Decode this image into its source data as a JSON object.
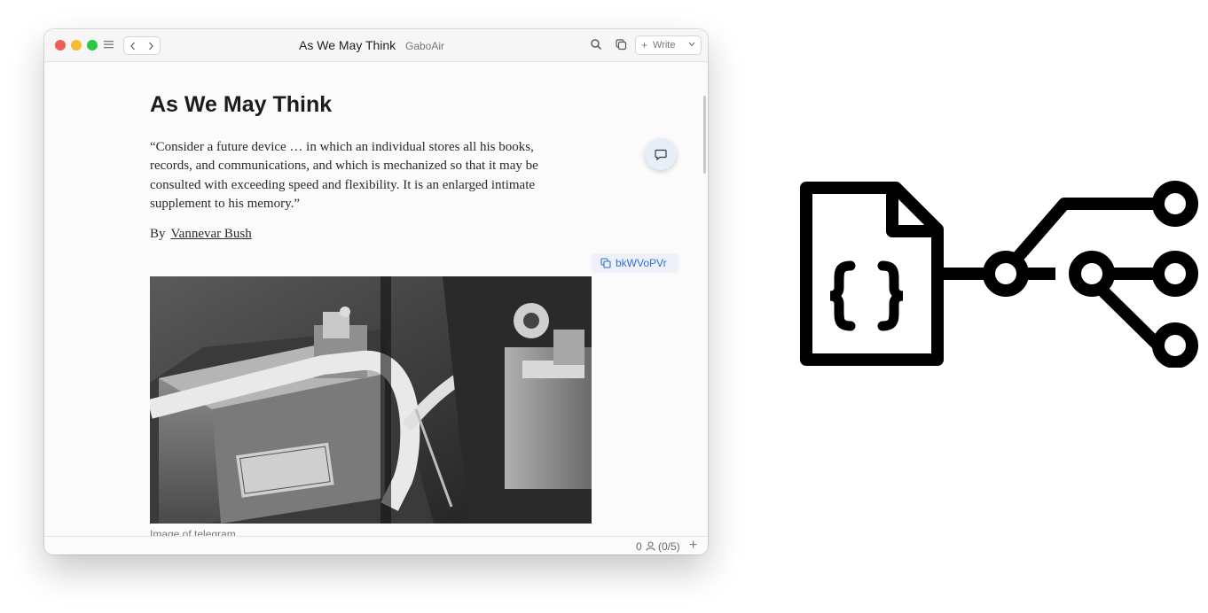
{
  "window": {
    "title": "As We May Think",
    "subtitle": "GaboAir",
    "write_label": "Write",
    "write_plus": "+"
  },
  "document": {
    "title": "As We May Think",
    "quote": "“Consider a future device …  in which an individual stores all his books, records, and communications, and which is mechanized so that it may be consulted with exceeding speed and flexibility. It is an enlarged intimate supplement to his memory.”",
    "by_label": "By",
    "author": "Vannevar Bush",
    "block_id": "bkWVoPVr",
    "image_caption": "Image of telegram"
  },
  "statusbar": {
    "count": "0",
    "ratio": "(0/5)",
    "add_label": "+"
  },
  "icons": {
    "menu": "sidebar-menu-icon",
    "back": "chevron-left-icon",
    "forward": "chevron-right-icon",
    "search": "search-icon",
    "duplicate": "duplicate-icon",
    "comment": "comment-icon",
    "copy": "copy-icon",
    "user": "user-icon",
    "logo": "json-file-branch-icon"
  },
  "colors": {
    "close": "#ec5f57",
    "minimize": "#f4bd2f",
    "zoom": "#2fc843",
    "link": "#2f6fd6",
    "logo": "#000000"
  }
}
